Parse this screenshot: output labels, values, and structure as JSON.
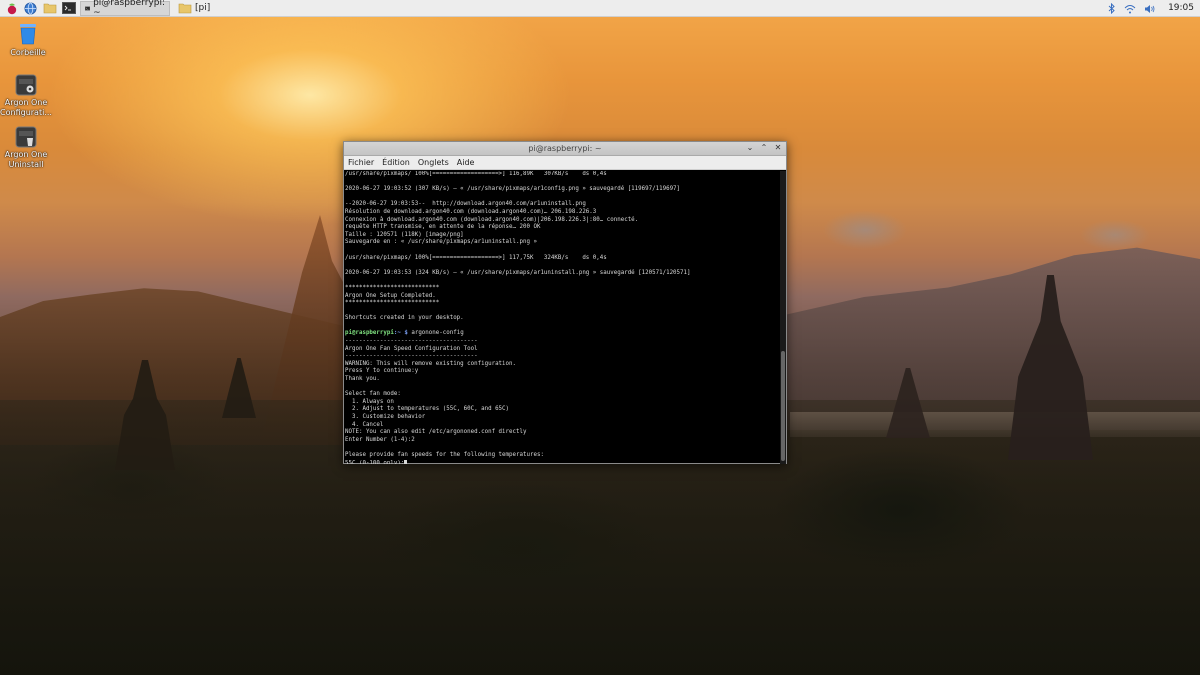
{
  "taskbar": {
    "tasks": [
      {
        "label": "pi@raspberrypi: ~",
        "icon": "terminal-icon",
        "active": true
      },
      {
        "label": "[pi]",
        "icon": "folder-icon",
        "active": false
      }
    ],
    "clock": "19:05"
  },
  "desktop": {
    "icons": [
      {
        "label": "Corbeille",
        "icon": "trash-icon"
      },
      {
        "label": "Argon One Configurati...",
        "icon": "argon-config-icon"
      },
      {
        "label": "Argon One Uninstall",
        "icon": "argon-uninstall-icon"
      }
    ]
  },
  "terminal": {
    "title": "pi@raspberrypi: ~",
    "menu": [
      "Fichier",
      "Édition",
      "Onglets",
      "Aide"
    ],
    "prompt_user": "pi@raspberrypi",
    "prompt_path": ":~ $",
    "command": " argonone-config",
    "lines_before": [
      "/usr/share/pixmaps/ 100%[===================>] 116,89K   307KB/s    ds 0,4s",
      "",
      "2020-06-27 19:03:52 (307 KB/s) — « /usr/share/pixmaps/ar1config.png » sauvegardé [119697/119697]",
      "",
      "--2020-06-27 19:03:53--  http://download.argon40.com/ar1uninstall.png",
      "Résolution de download.argon40.com (download.argon40.com)… 206.198.226.3",
      "Connexion à download.argon40.com (download.argon40.com)|206.198.226.3|:80… connecté.",
      "requête HTTP transmise, en attente de la réponse… 200 OK",
      "Taille : 120571 (118K) [image/png]",
      "Sauvegarde en : « /usr/share/pixmaps/ar1uninstall.png »",
      "",
      "/usr/share/pixmaps/ 100%[===================>] 117,75K   324KB/s    ds 0,4s",
      "",
      "2020-06-27 19:03:53 (324 KB/s) — « /usr/share/pixmaps/ar1uninstall.png » sauvegardé [120571/120571]",
      "",
      "***************************",
      "Argon One Setup Completed.",
      "***************************",
      "",
      "Shortcuts created in your desktop.",
      ""
    ],
    "lines_after": [
      "--------------------------------------",
      "Argon One Fan Speed Configuration Tool",
      "--------------------------------------",
      "WARNING: This will remove existing configuration.",
      "Press Y to continue:y",
      "Thank you.",
      "",
      "Select fan mode:",
      "  1. Always on",
      "  2. Adjust to temperatures (55C, 60C, and 65C)",
      "  3. Customize behavior",
      "  4. Cancel",
      "NOTE: You can also edit /etc/argononed.conf directly",
      "Enter Number (1-4):2",
      "",
      "Please provide fan speeds for the following temperatures:"
    ],
    "input_prompt": "55C (0-100 only):"
  }
}
